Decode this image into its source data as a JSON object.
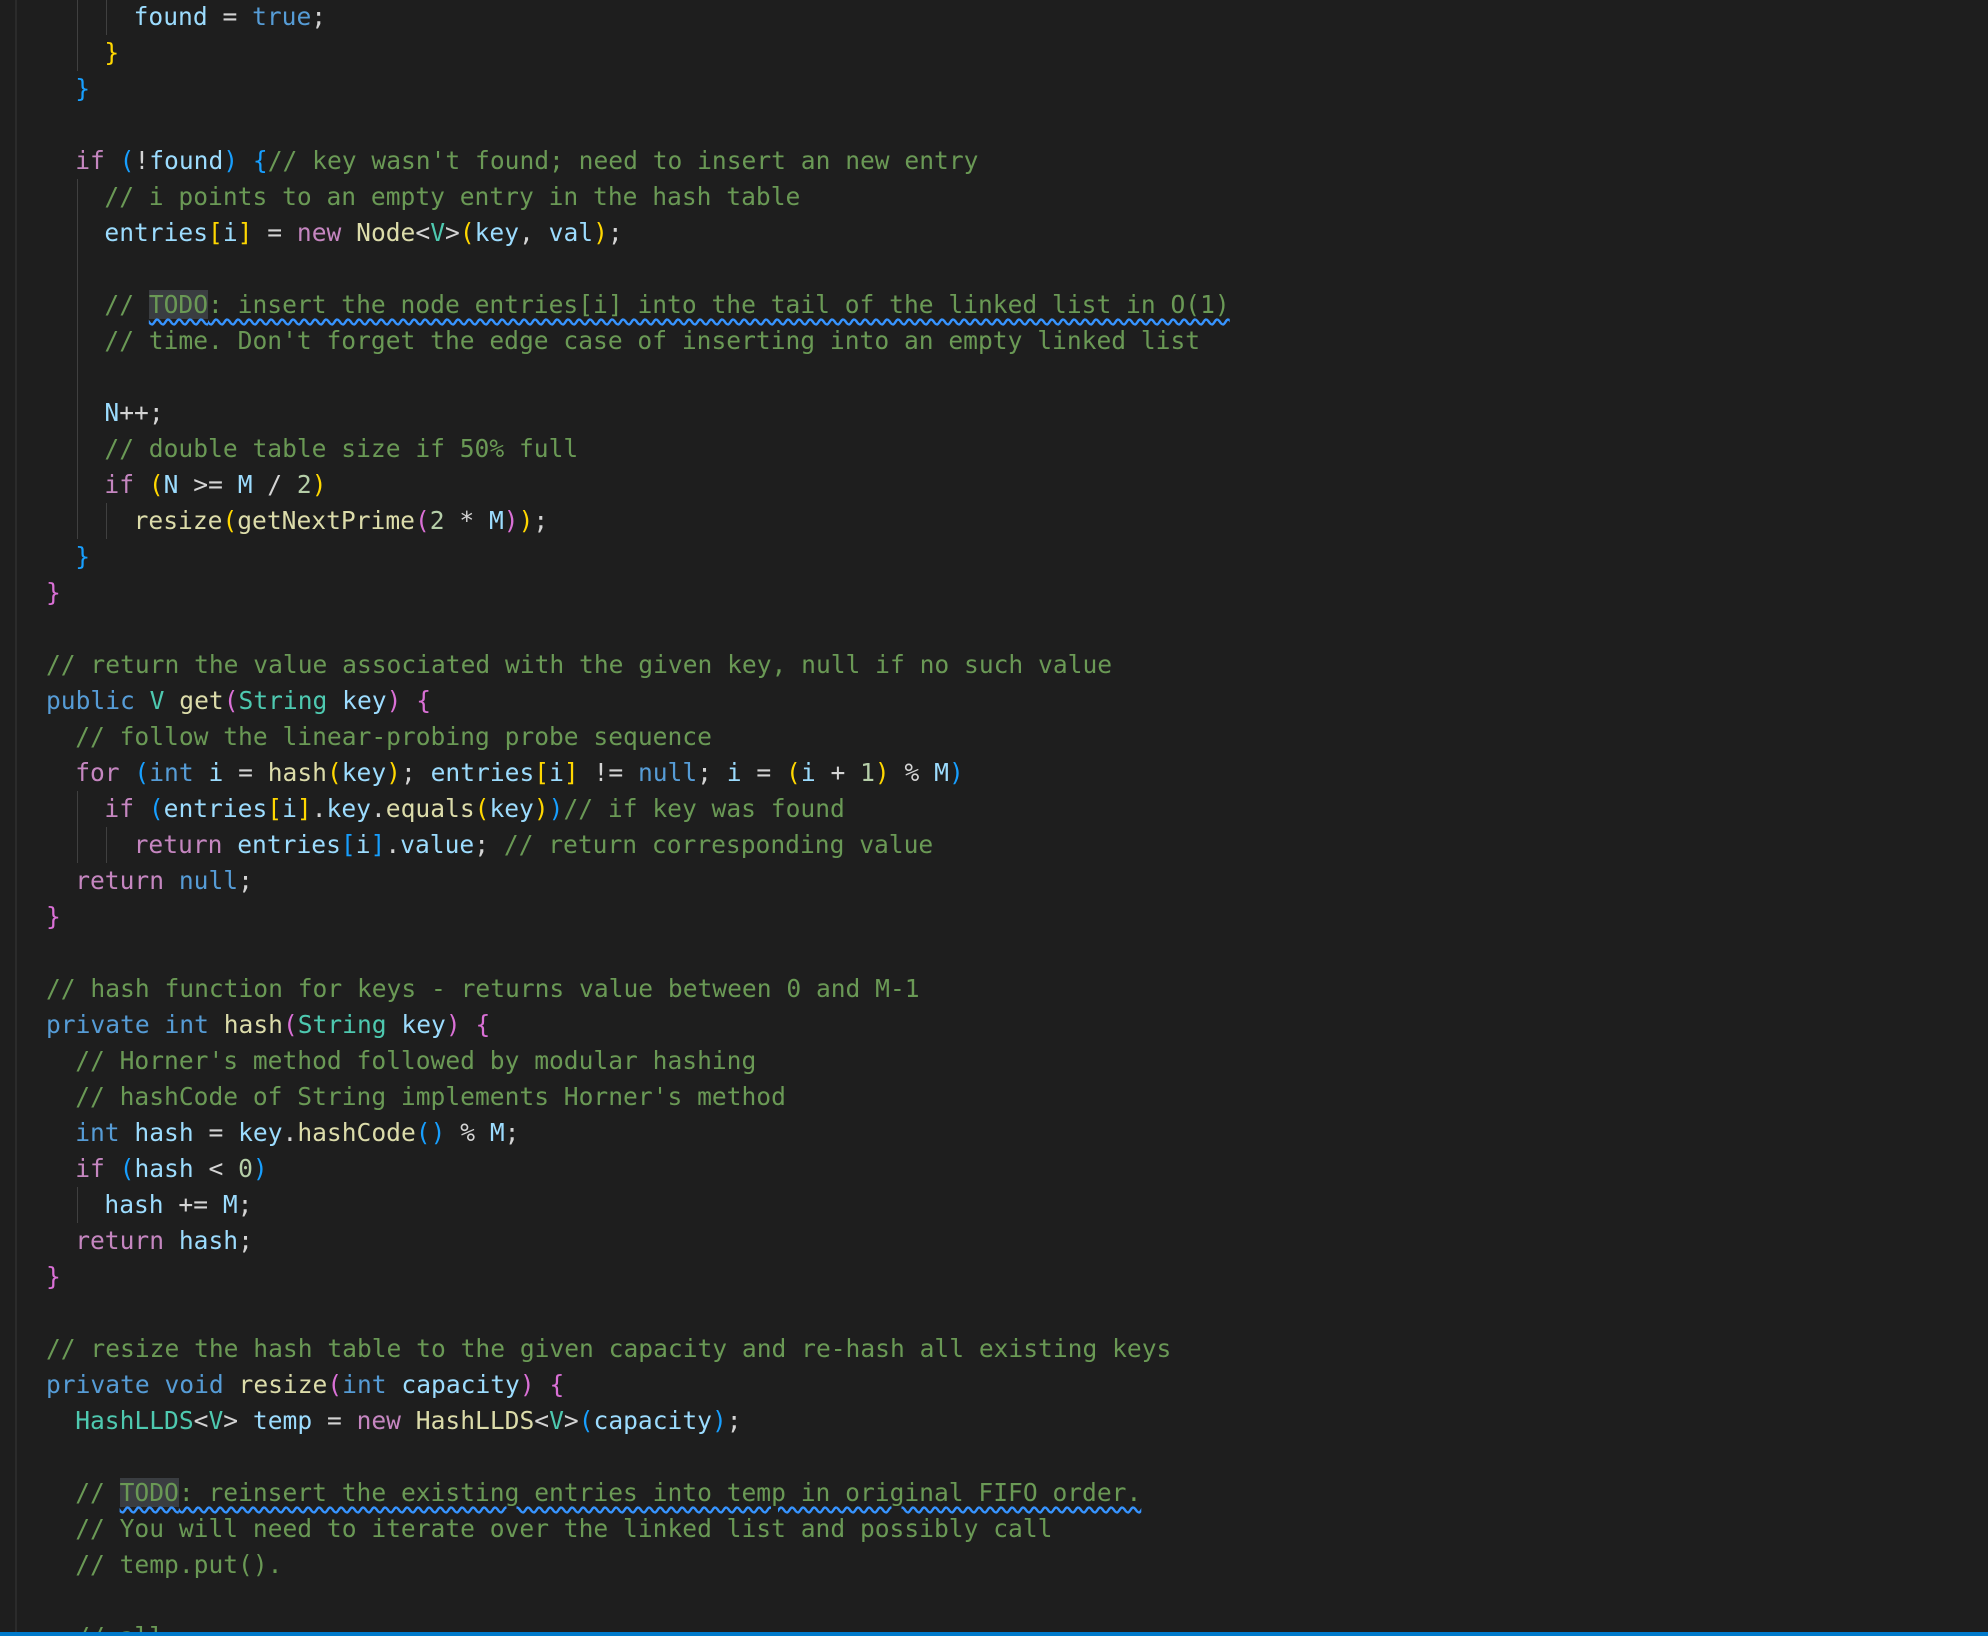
{
  "editor": {
    "language": "java",
    "colors": {
      "background": "#1e1e1e",
      "keyword": "#569cd6",
      "control": "#c586c0",
      "type": "#4ec9b0",
      "variable": "#9cdcfe",
      "function": "#dcdcaa",
      "number": "#b5cea8",
      "comment": "#6a9955",
      "bracket_gold": "#ffd700",
      "bracket_orchid": "#da70d6",
      "bracket_blue": "#179fff",
      "todo_squiggle": "#3794ff"
    },
    "lines": [
      {
        "indent": 3,
        "tokens": [
          [
            "found",
            "var"
          ],
          [
            " = ",
            "op"
          ],
          [
            "true",
            "kw"
          ],
          [
            ";",
            "op"
          ]
        ]
      },
      {
        "indent": 2,
        "tokens": [
          [
            "}",
            "b1"
          ]
        ]
      },
      {
        "indent": 1,
        "tokens": [
          [
            "}",
            "b3"
          ]
        ]
      },
      {
        "indent": 0,
        "tokens": []
      },
      {
        "indent": 1,
        "tokens": [
          [
            "if",
            "ctrl"
          ],
          [
            " ",
            "op"
          ],
          [
            "(",
            "b3"
          ],
          [
            "!",
            "op"
          ],
          [
            "found",
            "var"
          ],
          [
            ")",
            "b3"
          ],
          [
            " ",
            "op"
          ],
          [
            "{",
            "b3"
          ],
          [
            "// key wasn't found; need to insert an new entry",
            "cmt"
          ]
        ]
      },
      {
        "indent": 2,
        "tokens": [
          [
            "// i points to an empty entry in the hash table",
            "cmt"
          ]
        ]
      },
      {
        "indent": 2,
        "tokens": [
          [
            "entries",
            "var"
          ],
          [
            "[",
            "b1"
          ],
          [
            "i",
            "var"
          ],
          [
            "]",
            "b1"
          ],
          [
            " = ",
            "op"
          ],
          [
            "new",
            "ctrl"
          ],
          [
            " ",
            "op"
          ],
          [
            "Node",
            "fn"
          ],
          [
            "<",
            "op"
          ],
          [
            "V",
            "type"
          ],
          [
            ">",
            "op"
          ],
          [
            "(",
            "b1"
          ],
          [
            "key",
            "var"
          ],
          [
            ", ",
            "op"
          ],
          [
            "val",
            "var"
          ],
          [
            ")",
            "b1"
          ],
          [
            ";",
            "op"
          ]
        ]
      },
      {
        "indent": 2,
        "tokens": []
      },
      {
        "indent": 2,
        "tokens": [
          [
            "// ",
            "cmt"
          ],
          [
            "TODO",
            "todotag"
          ],
          [
            ": insert the node entries[i] into the tail of the linked list in O(1)",
            "todo"
          ]
        ]
      },
      {
        "indent": 2,
        "tokens": [
          [
            "// time. Don't forget the edge case of inserting into an empty linked list",
            "cmt"
          ]
        ]
      },
      {
        "indent": 2,
        "tokens": []
      },
      {
        "indent": 2,
        "tokens": [
          [
            "N",
            "var"
          ],
          [
            "++;",
            "op"
          ]
        ]
      },
      {
        "indent": 2,
        "tokens": [
          [
            "// double table size if 50% full",
            "cmt"
          ]
        ]
      },
      {
        "indent": 2,
        "tokens": [
          [
            "if",
            "ctrl"
          ],
          [
            " ",
            "op"
          ],
          [
            "(",
            "b1"
          ],
          [
            "N",
            "var"
          ],
          [
            " >= ",
            "op"
          ],
          [
            "M",
            "var"
          ],
          [
            " / ",
            "op"
          ],
          [
            "2",
            "num"
          ],
          [
            ")",
            "b1"
          ]
        ]
      },
      {
        "indent": 3,
        "tokens": [
          [
            "resize",
            "fn"
          ],
          [
            "(",
            "b1"
          ],
          [
            "getNextPrime",
            "fn"
          ],
          [
            "(",
            "b2"
          ],
          [
            "2",
            "num"
          ],
          [
            " * ",
            "op"
          ],
          [
            "M",
            "var"
          ],
          [
            ")",
            "b2"
          ],
          [
            ")",
            "b1"
          ],
          [
            ";",
            "op"
          ]
        ]
      },
      {
        "indent": 1,
        "tokens": [
          [
            "}",
            "b3"
          ]
        ]
      },
      {
        "indent": 0,
        "tokens": [
          [
            "}",
            "b2"
          ]
        ]
      },
      {
        "indent": 0,
        "tokens": []
      },
      {
        "indent": 0,
        "tokens": [
          [
            "// return the value associated with the given key, null if no such value",
            "cmt"
          ]
        ]
      },
      {
        "indent": 0,
        "tokens": [
          [
            "public",
            "kw"
          ],
          [
            " ",
            "op"
          ],
          [
            "V",
            "type"
          ],
          [
            " ",
            "op"
          ],
          [
            "get",
            "fn"
          ],
          [
            "(",
            "b2"
          ],
          [
            "String",
            "type"
          ],
          [
            " ",
            "op"
          ],
          [
            "key",
            "var"
          ],
          [
            ")",
            "b2"
          ],
          [
            " ",
            "op"
          ],
          [
            "{",
            "b2"
          ]
        ]
      },
      {
        "indent": 1,
        "tokens": [
          [
            "// follow the linear-probing probe sequence",
            "cmt"
          ]
        ]
      },
      {
        "indent": 1,
        "tokens": [
          [
            "for",
            "ctrl"
          ],
          [
            " ",
            "op"
          ],
          [
            "(",
            "b3"
          ],
          [
            "int",
            "kw"
          ],
          [
            " ",
            "op"
          ],
          [
            "i",
            "var"
          ],
          [
            " = ",
            "op"
          ],
          [
            "hash",
            "fn"
          ],
          [
            "(",
            "b1"
          ],
          [
            "key",
            "var"
          ],
          [
            ")",
            "b1"
          ],
          [
            "; ",
            "op"
          ],
          [
            "entries",
            "var"
          ],
          [
            "[",
            "b1"
          ],
          [
            "i",
            "var"
          ],
          [
            "]",
            "b1"
          ],
          [
            " != ",
            "op"
          ],
          [
            "null",
            "kw"
          ],
          [
            "; ",
            "op"
          ],
          [
            "i",
            "var"
          ],
          [
            " = ",
            "op"
          ],
          [
            "(",
            "b1"
          ],
          [
            "i",
            "var"
          ],
          [
            " + ",
            "op"
          ],
          [
            "1",
            "num"
          ],
          [
            ")",
            "b1"
          ],
          [
            " % ",
            "op"
          ],
          [
            "M",
            "var"
          ],
          [
            ")",
            "b3"
          ]
        ]
      },
      {
        "indent": 2,
        "tokens": [
          [
            "if",
            "ctrl"
          ],
          [
            " ",
            "op"
          ],
          [
            "(",
            "b3"
          ],
          [
            "entries",
            "var"
          ],
          [
            "[",
            "b1"
          ],
          [
            "i",
            "var"
          ],
          [
            "]",
            "b1"
          ],
          [
            ".",
            "op"
          ],
          [
            "key",
            "var"
          ],
          [
            ".",
            "op"
          ],
          [
            "equals",
            "fn"
          ],
          [
            "(",
            "b1"
          ],
          [
            "key",
            "var"
          ],
          [
            ")",
            "b1"
          ],
          [
            ")",
            "b3"
          ],
          [
            "// if key was found",
            "cmt"
          ]
        ]
      },
      {
        "indent": 3,
        "tokens": [
          [
            "return",
            "ctrl"
          ],
          [
            " ",
            "op"
          ],
          [
            "entries",
            "var"
          ],
          [
            "[",
            "b3"
          ],
          [
            "i",
            "var"
          ],
          [
            "]",
            "b3"
          ],
          [
            ".",
            "op"
          ],
          [
            "value",
            "var"
          ],
          [
            "; ",
            "op"
          ],
          [
            "// return corresponding value",
            "cmt"
          ]
        ]
      },
      {
        "indent": 1,
        "tokens": [
          [
            "return",
            "ctrl"
          ],
          [
            " ",
            "op"
          ],
          [
            "null",
            "kw"
          ],
          [
            ";",
            "op"
          ]
        ]
      },
      {
        "indent": 0,
        "tokens": [
          [
            "}",
            "b2"
          ]
        ]
      },
      {
        "indent": 0,
        "tokens": []
      },
      {
        "indent": 0,
        "tokens": [
          [
            "// hash function for keys - returns value between 0 and M-1",
            "cmt"
          ]
        ]
      },
      {
        "indent": 0,
        "tokens": [
          [
            "private",
            "kw"
          ],
          [
            " ",
            "op"
          ],
          [
            "int",
            "kw"
          ],
          [
            " ",
            "op"
          ],
          [
            "hash",
            "fn"
          ],
          [
            "(",
            "b2"
          ],
          [
            "String",
            "type"
          ],
          [
            " ",
            "op"
          ],
          [
            "key",
            "var"
          ],
          [
            ")",
            "b2"
          ],
          [
            " ",
            "op"
          ],
          [
            "{",
            "b2"
          ]
        ]
      },
      {
        "indent": 1,
        "tokens": [
          [
            "// Horner's method followed by modular hashing",
            "cmt"
          ]
        ]
      },
      {
        "indent": 1,
        "tokens": [
          [
            "// hashCode of String implements Horner's method",
            "cmt"
          ]
        ]
      },
      {
        "indent": 1,
        "tokens": [
          [
            "int",
            "kw"
          ],
          [
            " ",
            "op"
          ],
          [
            "hash",
            "var"
          ],
          [
            " = ",
            "op"
          ],
          [
            "key",
            "var"
          ],
          [
            ".",
            "op"
          ],
          [
            "hashCode",
            "fn"
          ],
          [
            "()",
            "b3"
          ],
          [
            " % ",
            "op"
          ],
          [
            "M",
            "var"
          ],
          [
            ";",
            "op"
          ]
        ]
      },
      {
        "indent": 1,
        "tokens": [
          [
            "if",
            "ctrl"
          ],
          [
            " ",
            "op"
          ],
          [
            "(",
            "b3"
          ],
          [
            "hash",
            "var"
          ],
          [
            " < ",
            "op"
          ],
          [
            "0",
            "num"
          ],
          [
            ")",
            "b3"
          ]
        ]
      },
      {
        "indent": 2,
        "tokens": [
          [
            "hash",
            "var"
          ],
          [
            " += ",
            "op"
          ],
          [
            "M",
            "var"
          ],
          [
            ";",
            "op"
          ]
        ]
      },
      {
        "indent": 1,
        "tokens": [
          [
            "return",
            "ctrl"
          ],
          [
            " ",
            "op"
          ],
          [
            "hash",
            "var"
          ],
          [
            ";",
            "op"
          ]
        ]
      },
      {
        "indent": 0,
        "tokens": [
          [
            "}",
            "b2"
          ]
        ]
      },
      {
        "indent": 0,
        "tokens": []
      },
      {
        "indent": 0,
        "tokens": [
          [
            "// resize the hash table to the given capacity and re-hash all existing keys",
            "cmt"
          ]
        ]
      },
      {
        "indent": 0,
        "tokens": [
          [
            "private",
            "kw"
          ],
          [
            " ",
            "op"
          ],
          [
            "void",
            "kw"
          ],
          [
            " ",
            "op"
          ],
          [
            "resize",
            "fn"
          ],
          [
            "(",
            "b2"
          ],
          [
            "int",
            "kw"
          ],
          [
            " ",
            "op"
          ],
          [
            "capacity",
            "var"
          ],
          [
            ")",
            "b2"
          ],
          [
            " ",
            "op"
          ],
          [
            "{",
            "b2"
          ]
        ]
      },
      {
        "indent": 1,
        "tokens": [
          [
            "HashLLDS",
            "type"
          ],
          [
            "<",
            "op"
          ],
          [
            "V",
            "type"
          ],
          [
            "> ",
            "op"
          ],
          [
            "temp",
            "var"
          ],
          [
            " = ",
            "op"
          ],
          [
            "new",
            "ctrl"
          ],
          [
            " ",
            "op"
          ],
          [
            "HashLLDS",
            "fn"
          ],
          [
            "<",
            "op"
          ],
          [
            "V",
            "type"
          ],
          [
            ">",
            "op"
          ],
          [
            "(",
            "b3"
          ],
          [
            "capacity",
            "var"
          ],
          [
            ")",
            "b3"
          ],
          [
            ";",
            "op"
          ]
        ]
      },
      {
        "indent": 1,
        "tokens": []
      },
      {
        "indent": 1,
        "tokens": [
          [
            "// ",
            "cmt"
          ],
          [
            "TODO",
            "todotag"
          ],
          [
            ": reinsert the existing entries into temp in original FIFO order.",
            "todo"
          ]
        ]
      },
      {
        "indent": 1,
        "tokens": [
          [
            "// You will need to iterate over the linked list and possibly call",
            "cmt"
          ]
        ]
      },
      {
        "indent": 1,
        "tokens": [
          [
            "// temp.put().",
            "cmt"
          ]
        ]
      },
      {
        "indent": 1,
        "tokens": []
      },
      {
        "indent": 1,
        "tokens": [
          [
            "// all",
            "cmt"
          ]
        ]
      }
    ]
  }
}
